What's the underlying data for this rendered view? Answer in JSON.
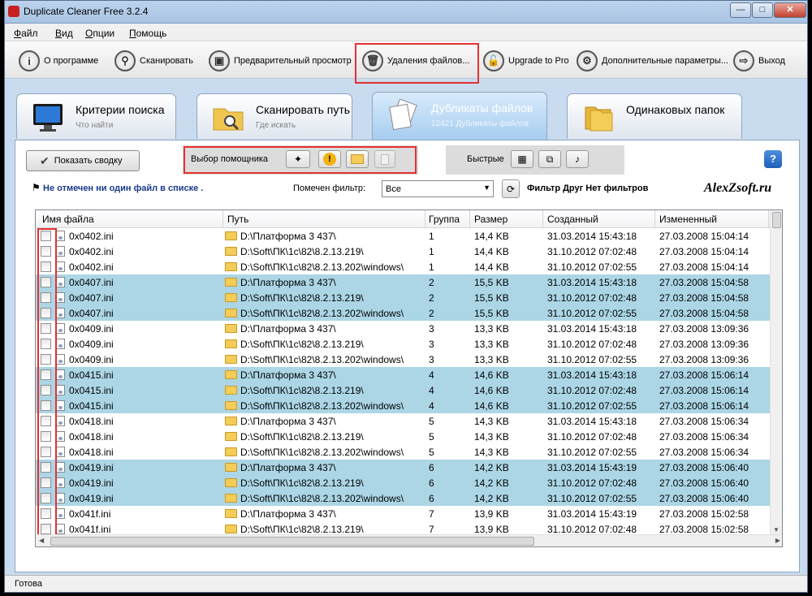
{
  "window": {
    "title": "Duplicate Cleaner Free 3.2.4"
  },
  "menu": [
    "Файл",
    "Вид",
    "Опции",
    "Помощь"
  ],
  "toolbar": [
    {
      "label": "О программе",
      "icon": "info-icon",
      "glyph": "i"
    },
    {
      "label": "Сканировать",
      "icon": "search-icon",
      "glyph": "⚲"
    },
    {
      "label": "Предварительный просмотр",
      "icon": "preview-icon",
      "glyph": "▣"
    },
    {
      "label": "Удаления файлов...",
      "icon": "trash-icon",
      "glyph": "🗑"
    },
    {
      "label": "Upgrade to Pro",
      "icon": "unlock-icon",
      "glyph": "🔓"
    },
    {
      "label": "Дополнительные параметры...",
      "icon": "gear-icon",
      "glyph": "⚙"
    },
    {
      "label": "Выход",
      "icon": "exit-icon",
      "glyph": "⇨"
    }
  ],
  "tabs": [
    {
      "title": "Критерии поиска",
      "sub": "Что найти"
    },
    {
      "title": "Сканировать путь",
      "sub": "Где искать"
    },
    {
      "title": "Дубликаты файлов",
      "sub": "12421 Дубликаты файлов"
    },
    {
      "title": "Одинаковых папок",
      "sub": ""
    }
  ],
  "panel": {
    "summary_button": "Показать сводку",
    "helper_label": "Выбор помощника",
    "fast_label": "Быстрые",
    "status_msg": "Не отмечен ни один файл в списке .",
    "filter_label": "Помечен фильтр:",
    "filter_value": "Все",
    "filter_info": "Фильтр Друг Нет фильтров",
    "watermark": "AlexZsoft.ru"
  },
  "columns": [
    "Имя файла",
    "Путь",
    "Группа",
    "Размер",
    "Созданный",
    "Измененный"
  ],
  "rows": [
    {
      "name": "0x0402.ini",
      "path": "D:\\Платформа 3 437\\",
      "group": "1",
      "size": "14,4 KB",
      "created": "31.03.2014 15:43:18",
      "modified": "27.03.2008 15:04:14",
      "hl": false
    },
    {
      "name": "0x0402.ini",
      "path": "D:\\Soft\\ПК\\1с\\82\\8.2.13.219\\",
      "group": "1",
      "size": "14,4 KB",
      "created": "31.10.2012 07:02:48",
      "modified": "27.03.2008 15:04:14",
      "hl": false
    },
    {
      "name": "0x0402.ini",
      "path": "D:\\Soft\\ПК\\1с\\82\\8.2.13.202\\windows\\",
      "group": "1",
      "size": "14,4 KB",
      "created": "31.10.2012 07:02:55",
      "modified": "27.03.2008 15:04:14",
      "hl": false
    },
    {
      "name": "0x0407.ini",
      "path": "D:\\Платформа 3 437\\",
      "group": "2",
      "size": "15,5 KB",
      "created": "31.03.2014 15:43:18",
      "modified": "27.03.2008 15:04:58",
      "hl": true
    },
    {
      "name": "0x0407.ini",
      "path": "D:\\Soft\\ПК\\1с\\82\\8.2.13.219\\",
      "group": "2",
      "size": "15,5 KB",
      "created": "31.10.2012 07:02:48",
      "modified": "27.03.2008 15:04:58",
      "hl": true
    },
    {
      "name": "0x0407.ini",
      "path": "D:\\Soft\\ПК\\1с\\82\\8.2.13.202\\windows\\",
      "group": "2",
      "size": "15,5 KB",
      "created": "31.10.2012 07:02:55",
      "modified": "27.03.2008 15:04:58",
      "hl": true
    },
    {
      "name": "0x0409.ini",
      "path": "D:\\Платформа 3 437\\",
      "group": "3",
      "size": "13,3 KB",
      "created": "31.03.2014 15:43:18",
      "modified": "27.03.2008 13:09:36",
      "hl": false
    },
    {
      "name": "0x0409.ini",
      "path": "D:\\Soft\\ПК\\1с\\82\\8.2.13.219\\",
      "group": "3",
      "size": "13,3 KB",
      "created": "31.10.2012 07:02:48",
      "modified": "27.03.2008 13:09:36",
      "hl": false
    },
    {
      "name": "0x0409.ini",
      "path": "D:\\Soft\\ПК\\1с\\82\\8.2.13.202\\windows\\",
      "group": "3",
      "size": "13,3 KB",
      "created": "31.10.2012 07:02:55",
      "modified": "27.03.2008 13:09:36",
      "hl": false
    },
    {
      "name": "0x0415.ini",
      "path": "D:\\Платформа 3 437\\",
      "group": "4",
      "size": "14,6 KB",
      "created": "31.03.2014 15:43:18",
      "modified": "27.03.2008 15:06:14",
      "hl": true
    },
    {
      "name": "0x0415.ini",
      "path": "D:\\Soft\\ПК\\1с\\82\\8.2.13.219\\",
      "group": "4",
      "size": "14,6 KB",
      "created": "31.10.2012 07:02:48",
      "modified": "27.03.2008 15:06:14",
      "hl": true
    },
    {
      "name": "0x0415.ini",
      "path": "D:\\Soft\\ПК\\1с\\82\\8.2.13.202\\windows\\",
      "group": "4",
      "size": "14,6 KB",
      "created": "31.10.2012 07:02:55",
      "modified": "27.03.2008 15:06:14",
      "hl": true
    },
    {
      "name": "0x0418.ini",
      "path": "D:\\Платформа 3 437\\",
      "group": "5",
      "size": "14,3 KB",
      "created": "31.03.2014 15:43:18",
      "modified": "27.03.2008 15:06:34",
      "hl": false
    },
    {
      "name": "0x0418.ini",
      "path": "D:\\Soft\\ПК\\1с\\82\\8.2.13.219\\",
      "group": "5",
      "size": "14,3 KB",
      "created": "31.10.2012 07:02:48",
      "modified": "27.03.2008 15:06:34",
      "hl": false
    },
    {
      "name": "0x0418.ini",
      "path": "D:\\Soft\\ПК\\1с\\82\\8.2.13.202\\windows\\",
      "group": "5",
      "size": "14,3 KB",
      "created": "31.10.2012 07:02:55",
      "modified": "27.03.2008 15:06:34",
      "hl": false
    },
    {
      "name": "0x0419.ini",
      "path": "D:\\Платформа 3 437\\",
      "group": "6",
      "size": "14,2 KB",
      "created": "31.03.2014 15:43:19",
      "modified": "27.03.2008 15:06:40",
      "hl": true
    },
    {
      "name": "0x0419.ini",
      "path": "D:\\Soft\\ПК\\1с\\82\\8.2.13.219\\",
      "group": "6",
      "size": "14,2 KB",
      "created": "31.10.2012 07:02:48",
      "modified": "27.03.2008 15:06:40",
      "hl": true
    },
    {
      "name": "0x0419.ini",
      "path": "D:\\Soft\\ПК\\1с\\82\\8.2.13.202\\windows\\",
      "group": "6",
      "size": "14,2 KB",
      "created": "31.10.2012 07:02:55",
      "modified": "27.03.2008 15:06:40",
      "hl": true
    },
    {
      "name": "0x041f.ini",
      "path": "D:\\Платформа 3 437\\",
      "group": "7",
      "size": "13,9 KB",
      "created": "31.03.2014 15:43:19",
      "modified": "27.03.2008 15:02:58",
      "hl": false
    },
    {
      "name": "0x041f.ini",
      "path": "D:\\Soft\\ПК\\1с\\82\\8.2.13.219\\",
      "group": "7",
      "size": "13,9 KB",
      "created": "31.10.2012 07:02:48",
      "modified": "27.03.2008 15:02:58",
      "hl": false
    }
  ],
  "status": "Готова",
  "colors": {
    "highlight_row": "#acd6e6",
    "annotation": "#e53030"
  }
}
